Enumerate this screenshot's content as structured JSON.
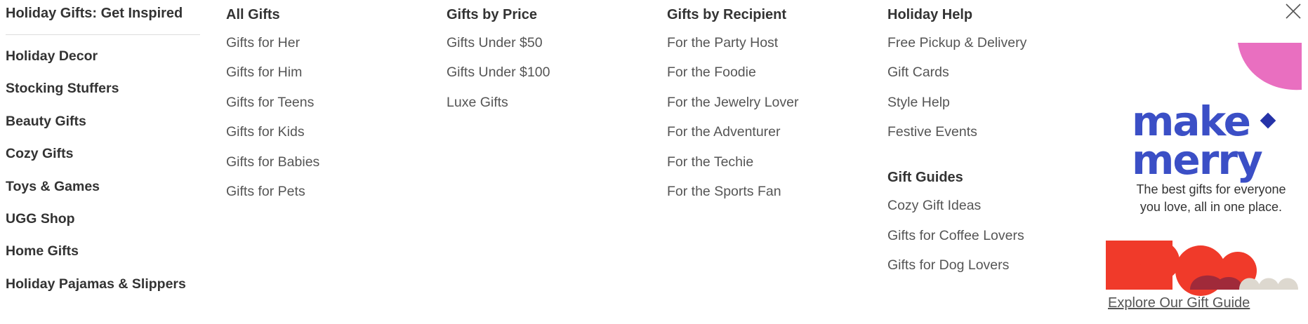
{
  "sidebar": {
    "title": "Holiday Gifts: Get Inspired",
    "items": [
      {
        "label": "Holiday Decor"
      },
      {
        "label": "Stocking Stuffers"
      },
      {
        "label": "Beauty Gifts"
      },
      {
        "label": "Cozy Gifts"
      },
      {
        "label": "Toys & Games"
      },
      {
        "label": "UGG Shop"
      },
      {
        "label": "Home Gifts"
      },
      {
        "label": "Holiday Pajamas & Slippers"
      }
    ]
  },
  "columns": [
    {
      "heading": "All Gifts",
      "links": [
        "Gifts for Her",
        "Gifts for Him",
        "Gifts for Teens",
        "Gifts for Kids",
        "Gifts for Babies",
        "Gifts for Pets"
      ]
    },
    {
      "heading": "Gifts by Price",
      "links": [
        "Gifts Under $50",
        "Gifts Under $100",
        "Luxe Gifts"
      ]
    },
    {
      "heading": "Gifts by Recipient",
      "links": [
        "For the Party Host",
        "For the Foodie",
        "For the Jewelry Lover",
        "For the Adventurer",
        "For the Techie",
        "For the Sports Fan"
      ]
    },
    {
      "heading": "Holiday Help",
      "links": [
        "Free Pickup & Delivery",
        "Gift Cards",
        "Style Help",
        "Festive Events"
      ],
      "sub_heading": "Gift Guides",
      "sub_links": [
        "Cozy Gift Ideas",
        "Gifts for Coffee Lovers",
        "Gifts for Dog Lovers"
      ]
    }
  ],
  "promo": {
    "logo_line1": "make",
    "logo_line2": "merry",
    "tagline_line1": "The best gifts for everyone",
    "tagline_line2": "you love, all in one place.",
    "cta": "Explore Our Gift Guide",
    "colors": {
      "logo_blue": "#3b4fc6",
      "pink": "#e96fc0",
      "red": "#f03a2a",
      "dark_red": "#a02a3a",
      "beige": "#ddd8cf"
    }
  },
  "close_icon": "close-icon"
}
